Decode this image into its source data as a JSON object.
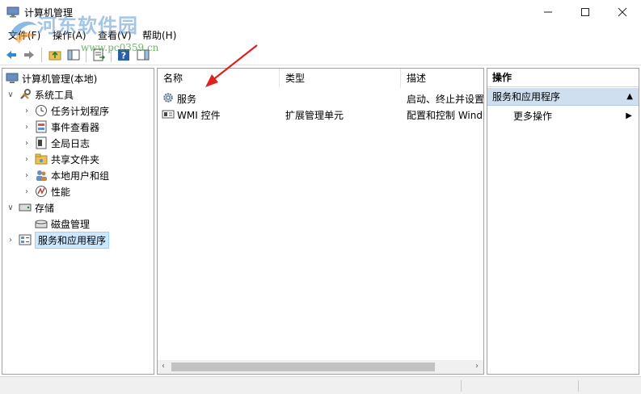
{
  "window": {
    "title": "计算机管理",
    "minimize_icon": "minimize-icon",
    "maximize_icon": "maximize-icon",
    "close_icon": "close-icon"
  },
  "watermark": {
    "text": "河东软件园",
    "url": "www.pc0359.cn"
  },
  "menu": [
    {
      "label": "文件(F)"
    },
    {
      "label": "操作(A)"
    },
    {
      "label": "查看(V)"
    },
    {
      "label": "帮助(H)"
    }
  ],
  "toolbar": {
    "icons": [
      "back-arrow-icon",
      "forward-arrow-icon",
      "up-folder-icon",
      "show-hide-tree-icon",
      "export-list-icon",
      "help-icon",
      "show-hide-action-pane-icon"
    ]
  },
  "tree": {
    "root": "计算机管理(本地)",
    "items": [
      {
        "label": "系统工具",
        "icon": "tools-icon",
        "expanded": true
      },
      {
        "label": "任务计划程序",
        "icon": "clock-icon"
      },
      {
        "label": "事件查看器",
        "icon": "event-viewer-icon"
      },
      {
        "label": "全局日志",
        "icon": "log-icon"
      },
      {
        "label": "共享文件夹",
        "icon": "shared-folder-icon"
      },
      {
        "label": "本地用户和组",
        "icon": "users-icon"
      },
      {
        "label": "性能",
        "icon": "performance-icon"
      },
      {
        "label": "存储",
        "icon": "storage-icon",
        "expanded": true
      },
      {
        "label": "磁盘管理",
        "icon": "disk-icon"
      },
      {
        "label": "服务和应用程序",
        "icon": "services-apps-icon",
        "selected": true
      }
    ]
  },
  "list": {
    "columns": [
      "名称",
      "类型",
      "描述"
    ],
    "rows": [
      {
        "name": "服务",
        "type": "",
        "desc": "启动、终止并设置",
        "icon": "gear-icon"
      },
      {
        "name": "WMI 控件",
        "type": "扩展管理单元",
        "desc": "配置和控制 Wind",
        "icon": "wmi-icon"
      }
    ]
  },
  "actions": {
    "header": "操作",
    "group": "服务和应用程序",
    "more": "更多操作"
  },
  "colors": {
    "selection": "#cce8ff",
    "action_group": "#cfdff0",
    "annotation_arrow": "#e02020"
  }
}
